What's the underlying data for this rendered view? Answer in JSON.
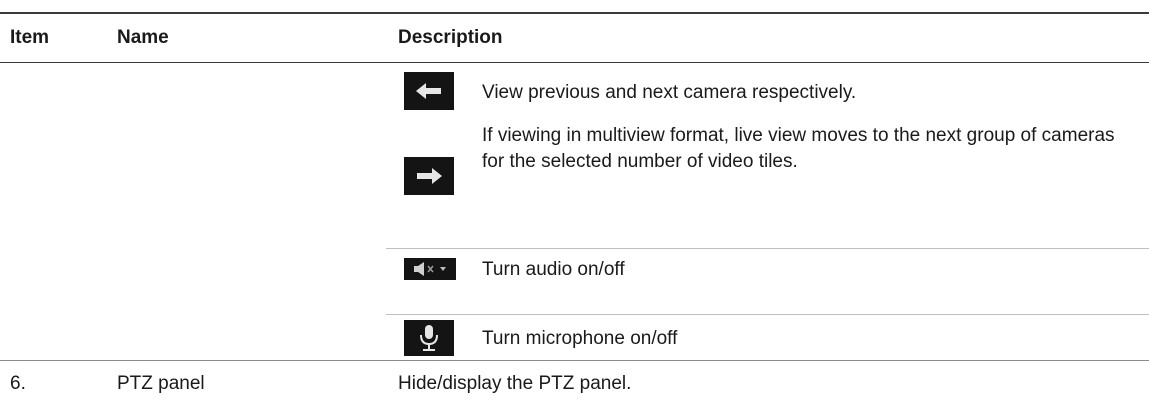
{
  "table": {
    "headers": {
      "item": "Item",
      "name": "Name",
      "description": "Description"
    },
    "icon_rows": [
      {
        "icon": "arrow-left-icon",
        "text": "View previous and next camera respectively."
      },
      {
        "icon": "arrow-right-icon",
        "text": "If viewing in multiview format, live view moves to the next group of cameras for the selected number of video tiles."
      },
      {
        "icon": "audio-mute-icon",
        "text": "Turn audio on/off"
      },
      {
        "icon": "microphone-icon",
        "text": "Turn microphone on/off"
      }
    ],
    "rows": [
      {
        "item": "6.",
        "name": "PTZ panel",
        "description": "Hide/display the PTZ panel."
      }
    ]
  },
  "colors": {
    "icon_background": "#141414",
    "icon_foreground": "#e6e6e6"
  }
}
